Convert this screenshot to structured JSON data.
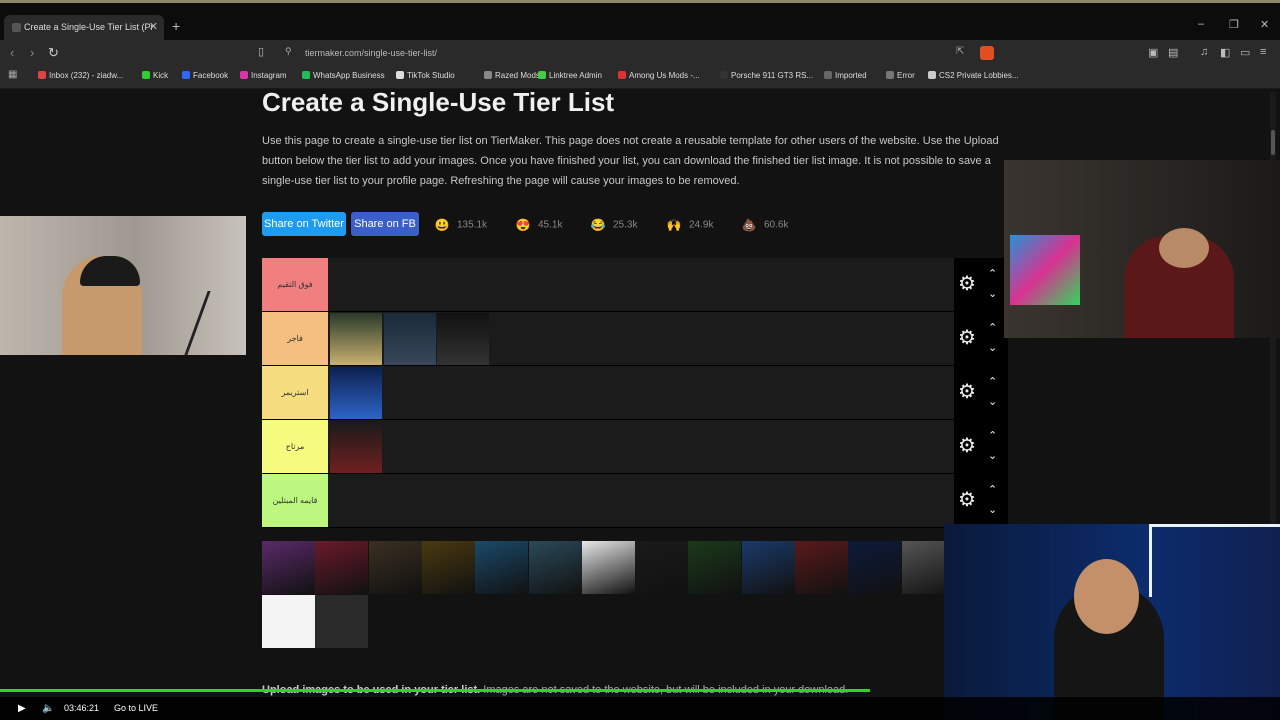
{
  "browser": {
    "tab_title": "Create a Single-Use Tier List (Pr",
    "url": "tiermaker.com/single-use-tier-list/",
    "bookmarks": [
      {
        "label": "Inbox (232) - ziadw...",
        "color": "#d44"
      },
      {
        "label": "Kick",
        "color": "#3c3"
      },
      {
        "label": "Facebook",
        "color": "#36f"
      },
      {
        "label": "Instagram",
        "color": "#d3a"
      },
      {
        "label": "WhatsApp Business",
        "color": "#2b5"
      },
      {
        "label": "TikTok Studio",
        "color": "#ddd"
      },
      {
        "label": "Razed Mods",
        "color": "#888"
      },
      {
        "label": "Linktree Admin",
        "color": "#4c4"
      },
      {
        "label": "Among Us Mods -...",
        "color": "#d33"
      },
      {
        "label": "Porsche 911 GT3 RS...",
        "color": "#333"
      },
      {
        "label": "Imported",
        "color": "#666"
      },
      {
        "label": "Error",
        "color": "#777"
      },
      {
        "label": "CS2 Private Lobbies...",
        "color": "#ccc"
      }
    ]
  },
  "page": {
    "title": "Create a Single-Use Tier List",
    "description": "Use this page to create a single-use tier list on TierMaker. This page does not create a reusable template for other users of the website. Use the Upload button below the tier list to add your images. Once you have finished your list, you can download the finished tier list image. It is not possible to save a single-use tier list to your profile page. Refreshing the page will cause your images to be removed.",
    "share_twitter": "Share on Twitter",
    "share_fb": "Share on FB",
    "reactions": [
      {
        "emoji": "😃",
        "count": "135.1k"
      },
      {
        "emoji": "😍",
        "count": "45.1k"
      },
      {
        "emoji": "😂",
        "count": "25.3k"
      },
      {
        "emoji": "🙌",
        "count": "24.9k"
      },
      {
        "emoji": "💩",
        "count": "60.6k"
      }
    ],
    "tiers": [
      {
        "label": "فوق التقيم",
        "color": "#f17f7f"
      },
      {
        "label": "فاجر",
        "color": "#f5bf80"
      },
      {
        "label": "استريمر",
        "color": "#f6de80"
      },
      {
        "label": "مرتاح",
        "color": "#f7fb80"
      },
      {
        "label": "قايمه المبتلين",
        "color": "#bef77f"
      }
    ],
    "upload_bold": "Upload images to be used in your tier list.",
    "upload_rest": " Images are not saved to the website, but will be included in your download."
  },
  "player": {
    "time": "03:46:21",
    "live_label": "Go to LIVE",
    "progress": 0.68
  }
}
